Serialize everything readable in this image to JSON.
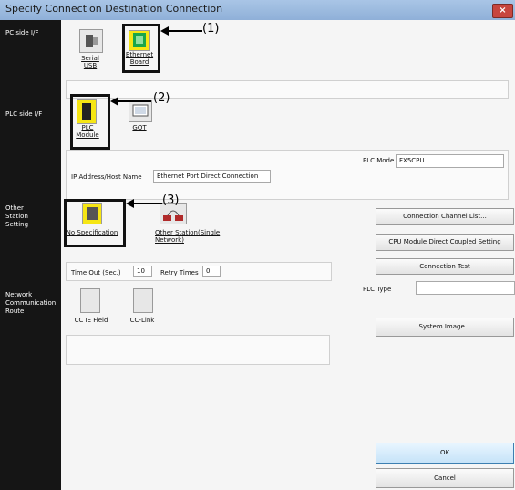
{
  "window": {
    "title": "Specify Connection Destination Connection",
    "close_label": "×"
  },
  "sidebar": {
    "pc_side_if": "PC side I/F",
    "plc_side_if": "PLC side I/F",
    "other_station": "Other\nStation\nSetting",
    "network_route": "Network\nCommunication\nRoute"
  },
  "pc_side": {
    "serial_usb": "Serial\nUSB",
    "ethernet_board": "Ethernet\nBoard",
    "callout": "(1)"
  },
  "plc_side": {
    "plc_module": "PLC\nModule",
    "got": "GOT",
    "callout": "(2)",
    "plc_mode_label": "PLC Mode",
    "plc_mode_value": "FX5CPU",
    "ip_label": "IP Address/Host Name",
    "ip_value": "Ethernet Port Direct Connection"
  },
  "other_station": {
    "no_specification": "No Specification",
    "other_station_single": "Other Station(Single\nNetwork)",
    "callout": "(3)",
    "timeout_label": "Time Out (Sec.)",
    "timeout_value": "10",
    "retry_label": "Retry Times",
    "retry_value": "0"
  },
  "network": {
    "cc_ie_field": "CC IE Field",
    "cc_link": "CC-Link"
  },
  "buttons": {
    "connection_channel_list": "Connection Channel List...",
    "cpu_direct": "CPU Module Direct Coupled Setting",
    "connection_test": "Connection Test",
    "plc_type_label": "PLC Type",
    "plc_type_value": "",
    "system_image": "System Image...",
    "ok": "OK",
    "cancel": "Cancel"
  },
  "colors": {
    "accent_yellow": "#f6e614",
    "sidebar": "#151515",
    "titlebar": "#9ebde2",
    "ok_blue": "#d6ecfb"
  }
}
